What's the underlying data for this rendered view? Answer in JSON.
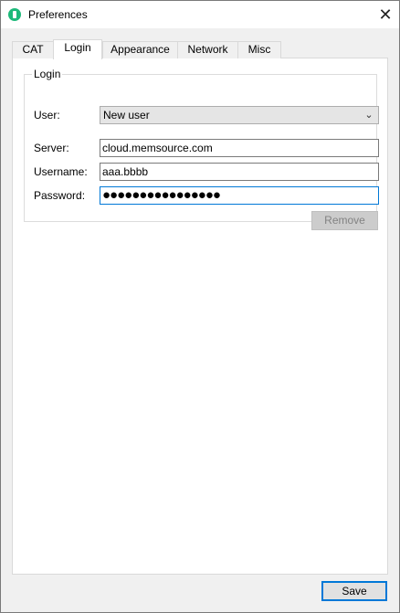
{
  "window": {
    "title": "Preferences",
    "close_glyph": "✕",
    "app_icon": "memsource-icon"
  },
  "tabs": [
    {
      "label": "CAT",
      "active": false
    },
    {
      "label": "Login",
      "active": true
    },
    {
      "label": "Appearance",
      "active": false
    },
    {
      "label": "Network",
      "active": false
    },
    {
      "label": "Misc",
      "active": false
    }
  ],
  "login": {
    "group_title": "Login",
    "user_label": "User:",
    "user_value": "New user",
    "dropdown_glyph": "⌄",
    "server_label": "Server:",
    "server_value": "cloud.memsource.com",
    "username_label": "Username:",
    "username_value": "aaa.bbbb",
    "password_label": "Password:",
    "password_masked": "●●●●●●●●●●●●●●●●",
    "remove_label": "Remove"
  },
  "footer": {
    "save_label": "Save"
  },
  "colors": {
    "focus_border": "#0078d7",
    "app_icon": "#1db97a",
    "disabled_text": "#838383"
  }
}
